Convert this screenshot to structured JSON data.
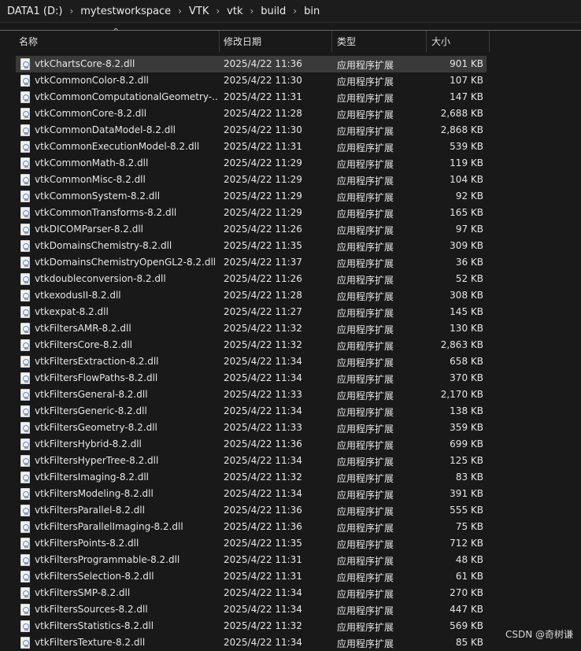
{
  "breadcrumb": [
    "DATA1 (D:)",
    "mytestworkspace",
    "VTK",
    "vtk",
    "build",
    "bin"
  ],
  "columns": {
    "name": "名称",
    "date": "修改日期",
    "type": "类型",
    "size": "大小"
  },
  "files": [
    {
      "name": "vtkChartsCore-8.2.dll",
      "date": "2025/4/22 11:36",
      "type": "应用程序扩展",
      "size": "901 KB",
      "selected": true
    },
    {
      "name": "vtkCommonColor-8.2.dll",
      "date": "2025/4/22 11:30",
      "type": "应用程序扩展",
      "size": "107 KB"
    },
    {
      "name": "vtkCommonComputationalGeometry-...",
      "date": "2025/4/22 11:31",
      "type": "应用程序扩展",
      "size": "147 KB"
    },
    {
      "name": "vtkCommonCore-8.2.dll",
      "date": "2025/4/22 11:28",
      "type": "应用程序扩展",
      "size": "2,688 KB"
    },
    {
      "name": "vtkCommonDataModel-8.2.dll",
      "date": "2025/4/22 11:30",
      "type": "应用程序扩展",
      "size": "2,868 KB"
    },
    {
      "name": "vtkCommonExecutionModel-8.2.dll",
      "date": "2025/4/22 11:31",
      "type": "应用程序扩展",
      "size": "539 KB"
    },
    {
      "name": "vtkCommonMath-8.2.dll",
      "date": "2025/4/22 11:29",
      "type": "应用程序扩展",
      "size": "119 KB"
    },
    {
      "name": "vtkCommonMisc-8.2.dll",
      "date": "2025/4/22 11:29",
      "type": "应用程序扩展",
      "size": "104 KB"
    },
    {
      "name": "vtkCommonSystem-8.2.dll",
      "date": "2025/4/22 11:29",
      "type": "应用程序扩展",
      "size": "92 KB"
    },
    {
      "name": "vtkCommonTransforms-8.2.dll",
      "date": "2025/4/22 11:29",
      "type": "应用程序扩展",
      "size": "165 KB"
    },
    {
      "name": "vtkDICOMParser-8.2.dll",
      "date": "2025/4/22 11:26",
      "type": "应用程序扩展",
      "size": "97 KB"
    },
    {
      "name": "vtkDomainsChemistry-8.2.dll",
      "date": "2025/4/22 11:35",
      "type": "应用程序扩展",
      "size": "309 KB"
    },
    {
      "name": "vtkDomainsChemistryOpenGL2-8.2.dll",
      "date": "2025/4/22 11:37",
      "type": "应用程序扩展",
      "size": "36 KB"
    },
    {
      "name": "vtkdoubleconversion-8.2.dll",
      "date": "2025/4/22 11:26",
      "type": "应用程序扩展",
      "size": "52 KB"
    },
    {
      "name": "vtkexodusII-8.2.dll",
      "date": "2025/4/22 11:28",
      "type": "应用程序扩展",
      "size": "308 KB"
    },
    {
      "name": "vtkexpat-8.2.dll",
      "date": "2025/4/22 11:27",
      "type": "应用程序扩展",
      "size": "145 KB"
    },
    {
      "name": "vtkFiltersAMR-8.2.dll",
      "date": "2025/4/22 11:32",
      "type": "应用程序扩展",
      "size": "130 KB"
    },
    {
      "name": "vtkFiltersCore-8.2.dll",
      "date": "2025/4/22 11:32",
      "type": "应用程序扩展",
      "size": "2,863 KB"
    },
    {
      "name": "vtkFiltersExtraction-8.2.dll",
      "date": "2025/4/22 11:34",
      "type": "应用程序扩展",
      "size": "658 KB"
    },
    {
      "name": "vtkFiltersFlowPaths-8.2.dll",
      "date": "2025/4/22 11:34",
      "type": "应用程序扩展",
      "size": "370 KB"
    },
    {
      "name": "vtkFiltersGeneral-8.2.dll",
      "date": "2025/4/22 11:33",
      "type": "应用程序扩展",
      "size": "2,170 KB"
    },
    {
      "name": "vtkFiltersGeneric-8.2.dll",
      "date": "2025/4/22 11:34",
      "type": "应用程序扩展",
      "size": "138 KB"
    },
    {
      "name": "vtkFiltersGeometry-8.2.dll",
      "date": "2025/4/22 11:33",
      "type": "应用程序扩展",
      "size": "359 KB"
    },
    {
      "name": "vtkFiltersHybrid-8.2.dll",
      "date": "2025/4/22 11:36",
      "type": "应用程序扩展",
      "size": "699 KB"
    },
    {
      "name": "vtkFiltersHyperTree-8.2.dll",
      "date": "2025/4/22 11:34",
      "type": "应用程序扩展",
      "size": "125 KB"
    },
    {
      "name": "vtkFiltersImaging-8.2.dll",
      "date": "2025/4/22 11:32",
      "type": "应用程序扩展",
      "size": "83 KB"
    },
    {
      "name": "vtkFiltersModeling-8.2.dll",
      "date": "2025/4/22 11:34",
      "type": "应用程序扩展",
      "size": "391 KB"
    },
    {
      "name": "vtkFiltersParallel-8.2.dll",
      "date": "2025/4/22 11:36",
      "type": "应用程序扩展",
      "size": "555 KB"
    },
    {
      "name": "vtkFiltersParallelImaging-8.2.dll",
      "date": "2025/4/22 11:36",
      "type": "应用程序扩展",
      "size": "75 KB"
    },
    {
      "name": "vtkFiltersPoints-8.2.dll",
      "date": "2025/4/22 11:35",
      "type": "应用程序扩展",
      "size": "712 KB"
    },
    {
      "name": "vtkFiltersProgrammable-8.2.dll",
      "date": "2025/4/22 11:31",
      "type": "应用程序扩展",
      "size": "48 KB"
    },
    {
      "name": "vtkFiltersSelection-8.2.dll",
      "date": "2025/4/22 11:31",
      "type": "应用程序扩展",
      "size": "61 KB"
    },
    {
      "name": "vtkFiltersSMP-8.2.dll",
      "date": "2025/4/22 11:34",
      "type": "应用程序扩展",
      "size": "270 KB"
    },
    {
      "name": "vtkFiltersSources-8.2.dll",
      "date": "2025/4/22 11:34",
      "type": "应用程序扩展",
      "size": "447 KB"
    },
    {
      "name": "vtkFiltersStatistics-8.2.dll",
      "date": "2025/4/22 11:32",
      "type": "应用程序扩展",
      "size": "569 KB"
    },
    {
      "name": "vtkFiltersTexture-8.2.dll",
      "date": "2025/4/22 11:34",
      "type": "应用程序扩展",
      "size": "85 KB"
    }
  ],
  "watermark": "CSDN @奇树谦",
  "colors": {
    "background": "#191919",
    "selected_row": "#3a3a3a",
    "text": "#e6e6e6"
  },
  "icons": {
    "file": "dll-file-icon"
  }
}
